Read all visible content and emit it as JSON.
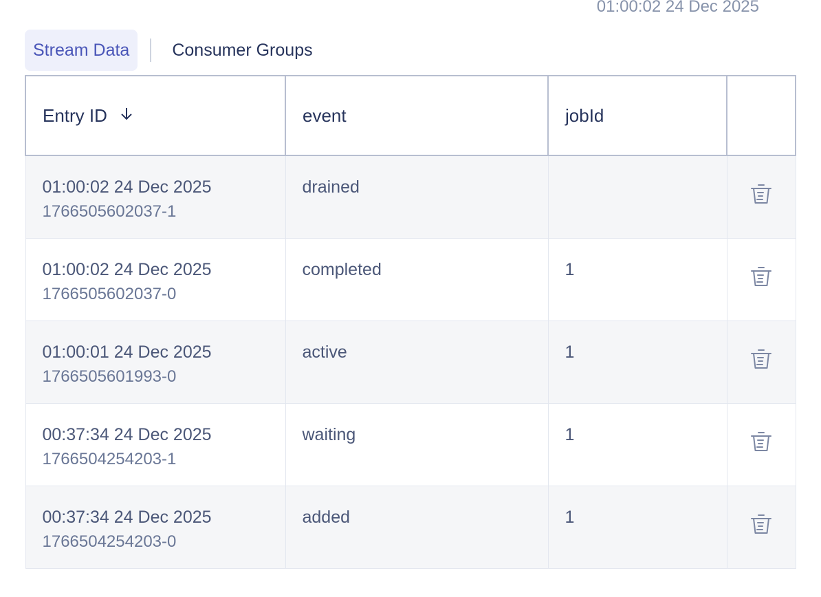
{
  "header": {
    "timestamp": "01:00:02 24 Dec 2025"
  },
  "tabs": [
    {
      "label": "Stream Data",
      "active": true
    },
    {
      "label": "Consumer Groups",
      "active": false
    }
  ],
  "table": {
    "columns": [
      "Entry ID",
      "event",
      "jobId",
      ""
    ],
    "rows": [
      {
        "timestamp": "01:00:02 24 Dec 2025",
        "entry_id": "1766505602037-1",
        "event": "drained",
        "jobId": ""
      },
      {
        "timestamp": "01:00:02 24 Dec 2025",
        "entry_id": "1766505602037-0",
        "event": "completed",
        "jobId": "1"
      },
      {
        "timestamp": "01:00:01 24 Dec 2025",
        "entry_id": "1766505601993-0",
        "event": "active",
        "jobId": "1"
      },
      {
        "timestamp": "00:37:34 24 Dec 2025",
        "entry_id": "1766504254203-1",
        "event": "waiting",
        "jobId": "1"
      },
      {
        "timestamp": "00:37:34 24 Dec 2025",
        "entry_id": "1766504254203-0",
        "event": "added",
        "jobId": "1"
      }
    ]
  },
  "icons": {
    "sort": "arrow-down-icon",
    "delete": "trash-icon"
  },
  "colors": {
    "accent": "#4a56b8",
    "tab_active_bg": "#eef0fb",
    "text": "#27345c",
    "muted": "#8793ab"
  }
}
